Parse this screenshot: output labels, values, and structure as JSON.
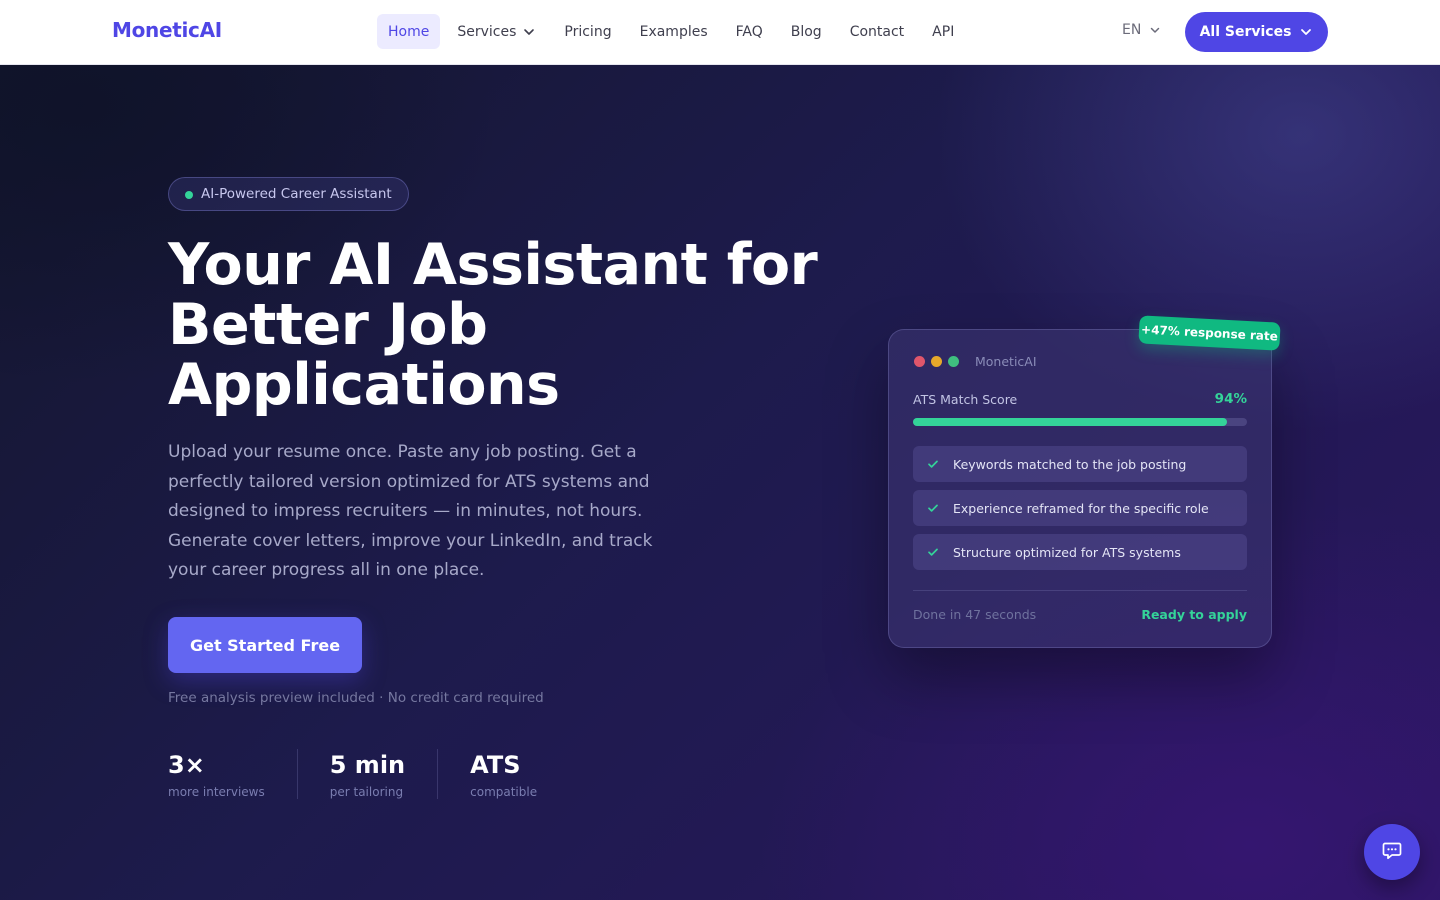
{
  "nav": {
    "logo": "MoneticAI",
    "links": [
      {
        "label": "Home",
        "active": true
      },
      {
        "label": "Services",
        "has_dropdown": true
      },
      {
        "label": "Pricing"
      },
      {
        "label": "Examples"
      },
      {
        "label": "FAQ"
      },
      {
        "label": "Blog"
      },
      {
        "label": "Contact"
      },
      {
        "label": "API"
      }
    ],
    "language": "EN",
    "all_services_label": "All Services"
  },
  "hero": {
    "pill_label": "AI-Powered Career Assistant",
    "headline": "Your AI Assistant for Better Job Applications",
    "subtext": "Upload your resume once. Paste any job posting. Get a perfectly tailored version optimized for ATS systems and designed to impress recruiters — in minutes, not hours. Generate cover letters, improve your LinkedIn, and track your career progress all in one place.",
    "cta_label": "Get Started Free",
    "cta_note": "Free analysis preview included · No credit card required",
    "stats": [
      {
        "value": "3×",
        "label": "more interviews"
      },
      {
        "value": "5 min",
        "label": "per tailoring"
      },
      {
        "value": "ATS",
        "label": "compatible"
      }
    ]
  },
  "card": {
    "badge": "+47% response rate",
    "title": "MoneticAI",
    "window_dot_colors": [
      "#e0566b",
      "#e6a82a",
      "#3fbf7f"
    ],
    "score_label": "ATS Match Score",
    "score_value": "94%",
    "score_fraction": 0.94,
    "checks": [
      "Keywords matched to the job posting",
      "Experience reframed for the specific role",
      "Structure optimized for ATS systems"
    ],
    "footer_left": "Done in 47 seconds",
    "footer_right": "Ready to apply"
  },
  "colors": {
    "brand": "#4f46e5",
    "accent_green": "#34d399",
    "hero_bg": "#1d1b4c"
  },
  "icons": {
    "dropdown": "chevron-down-icon",
    "check": "check-icon",
    "chat": "chat-bubble-icon"
  }
}
